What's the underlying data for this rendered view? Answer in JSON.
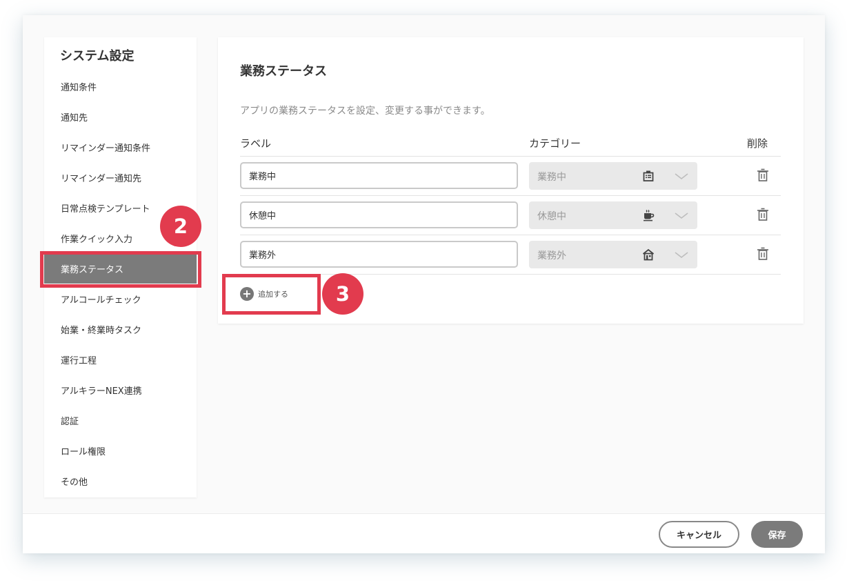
{
  "sidebar": {
    "title": "システム設定",
    "items": [
      {
        "label": "通知条件"
      },
      {
        "label": "通知先"
      },
      {
        "label": "リマインダー通知条件"
      },
      {
        "label": "リマインダー通知先"
      },
      {
        "label": "日常点検テンプレート"
      },
      {
        "label": "作業クイック入力"
      },
      {
        "label": "業務ステータス",
        "active": true
      },
      {
        "label": "アルコールチェック"
      },
      {
        "label": "始業・終業時タスク"
      },
      {
        "label": "運行工程"
      },
      {
        "label": "アルキラーNEX連携"
      },
      {
        "label": "認証"
      },
      {
        "label": "ロール権限"
      },
      {
        "label": "その他"
      }
    ]
  },
  "main": {
    "title": "業務ステータス",
    "description": "アプリの業務ステータスを設定、変更する事ができます。",
    "columns": {
      "label": "ラベル",
      "category": "カテゴリー",
      "delete": "削除"
    },
    "rows": [
      {
        "label": "業務中",
        "category": "業務中",
        "category_icon": "office-building-icon"
      },
      {
        "label": "休憩中",
        "category": "休憩中",
        "category_icon": "coffee-cup-icon"
      },
      {
        "label": "業務外",
        "category": "業務外",
        "category_icon": "house-icon"
      }
    ],
    "add_label": "追加する"
  },
  "footer": {
    "cancel_label": "キャンセル",
    "save_label": "保存"
  },
  "annotations": {
    "step2": "2",
    "step3": "3"
  },
  "colors": {
    "accent": "#e23b4e",
    "active_bg": "#7b7b7b",
    "select_bg": "#e9e9e9"
  }
}
